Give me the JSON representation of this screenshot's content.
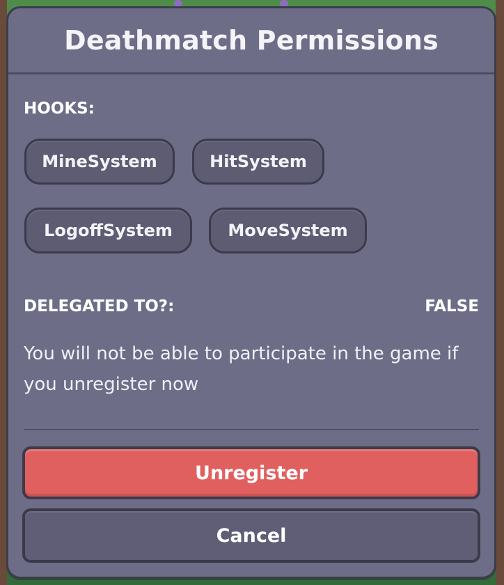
{
  "dialog": {
    "title": "Deathmatch Permissions",
    "hooks_label": "HOOKS:",
    "hooks": [
      "MineSystem",
      "HitSystem",
      "LogoffSystem",
      "MoveSystem"
    ],
    "delegated_label": "DELEGATED TO?:",
    "delegated_value": "FALSE",
    "warning": "You will not be able to participate in the game if you unregister now",
    "unregister_label": "Unregister",
    "cancel_label": "Cancel"
  },
  "colors": {
    "panel": "#6e6d88",
    "chip": "#5d5c73",
    "danger": "#e0605f",
    "cancel": "#5f5e76"
  }
}
